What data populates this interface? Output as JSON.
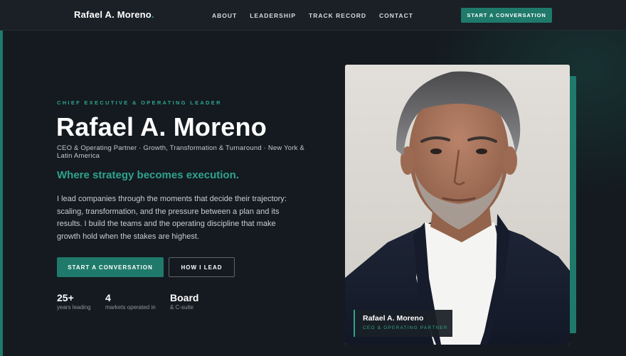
{
  "nav": {
    "brand": "Rafael A. Moreno",
    "brand_dot": ".",
    "links": [
      "ABOUT",
      "LEADERSHIP",
      "TRACK RECORD",
      "CONTACT"
    ],
    "cta": "START A CONVERSATION"
  },
  "hero": {
    "eyebrow": "CHIEF EXECUTIVE & OPERATING LEADER",
    "name": "Rafael A. Moreno",
    "subtitle": "CEO & Operating Partner · Growth, Transformation & Turnaround · New York & Latin America",
    "tagline": "Where strategy becomes execution.",
    "body": "I lead companies through the moments that decide their trajectory: scaling, transformation, and the pressure between a plan and its results. I build the teams and the operating discipline that make growth hold when the stakes are highest.",
    "primary_button": "START A CONVERSATION",
    "secondary_button": "HOW I LEAD",
    "stats": [
      {
        "value": "25+",
        "label": "years leading"
      },
      {
        "value": "4",
        "label": "markets operated in"
      },
      {
        "value": "Board",
        "label": "& C-suite"
      }
    ]
  },
  "portrait": {
    "caption_name": "Rafael A. Moreno",
    "caption_role": "CEO & OPERATING PARTNER"
  },
  "colors": {
    "background": "#141a20",
    "accent": "#1f7a6b",
    "accent_text": "#2fa38c"
  }
}
